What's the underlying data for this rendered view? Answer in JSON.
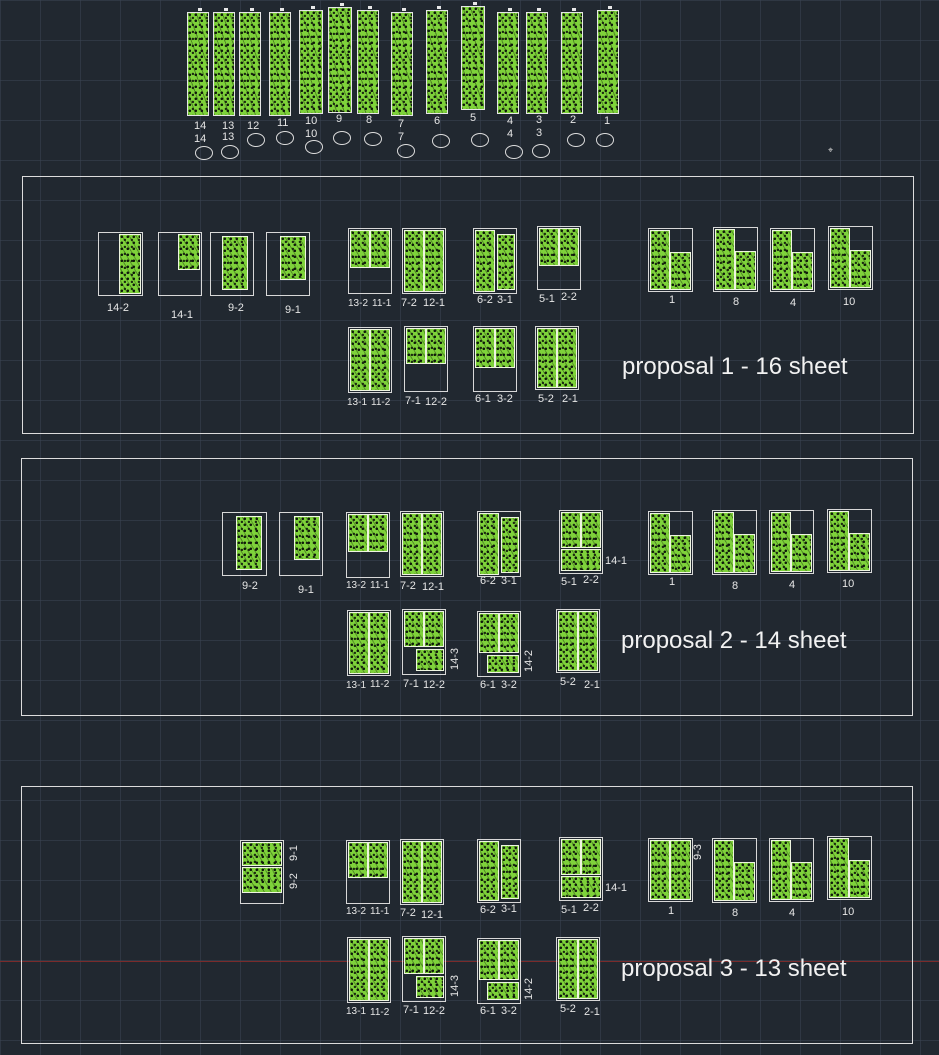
{
  "top_row": {
    "labels": [
      "14",
      "13",
      "12",
      "11",
      "10",
      "9",
      "8",
      "7",
      "6",
      "5",
      "4",
      "3",
      "2",
      "1"
    ],
    "sublabels": [
      "14",
      "13",
      "10",
      "7",
      "4",
      "3"
    ]
  },
  "proposals": [
    {
      "title": "proposal 1 - 16 sheet",
      "labels": {
        "a": "14-2",
        "b": "14-1",
        "c": "9-2",
        "d": "9-1",
        "e": "13-2",
        "f": "11-1",
        "g": "7-2",
        "h": "12-1",
        "i": "6-2",
        "j": "3-1",
        "k": "5-1",
        "l": "2-2",
        "m": "1",
        "n": "8",
        "o": "4",
        "p": "10",
        "q": "13-1",
        "r": "11-2",
        "s": "7-1",
        "t": "12-2",
        "u": "6-1",
        "v": "3-2",
        "w": "5-2",
        "x": "2-1"
      }
    },
    {
      "title": "proposal 2 - 14 sheet",
      "labels": {
        "c": "9-2",
        "d": "9-1",
        "e": "13-2",
        "f": "11-1",
        "g": "7-2",
        "h": "12-1",
        "i": "6-2",
        "j": "3-1",
        "k": "5-1",
        "l": "2-2",
        "y": "14-1",
        "m": "1",
        "n": "8",
        "o": "4",
        "p": "10",
        "q": "13-1",
        "r": "11-2",
        "s": "7-1",
        "t": "12-2",
        "z": "14-3",
        "u": "6-1",
        "v": "3-2",
        "aa": "14-2",
        "w": "5-2",
        "x": "2-1"
      }
    },
    {
      "title": "proposal 3 - 13 sheet",
      "labels": {
        "d": "9-1",
        "c": "9-2",
        "e": "13-2",
        "f": "11-1",
        "g": "7-2",
        "h": "12-1",
        "i": "6-2",
        "j": "3-1",
        "k": "5-1",
        "l": "2-2",
        "y": "14-1",
        "m": "1",
        "bb": "9-3",
        "n": "8",
        "o": "4",
        "p": "10",
        "q": "13-1",
        "r": "11-2",
        "s": "7-1",
        "t": "12-2",
        "z": "14-3",
        "u": "6-1",
        "v": "3-2",
        "aa": "14-2",
        "w": "5-2",
        "x": "2-1"
      }
    }
  ],
  "colors": {
    "background": "#212830",
    "panel_green": "#7ed23a",
    "outline": "#dcdcdc",
    "axis_red": "#7a2b2b"
  },
  "icons": {
    "cursor_marker": "crosshair-marker-icon"
  }
}
